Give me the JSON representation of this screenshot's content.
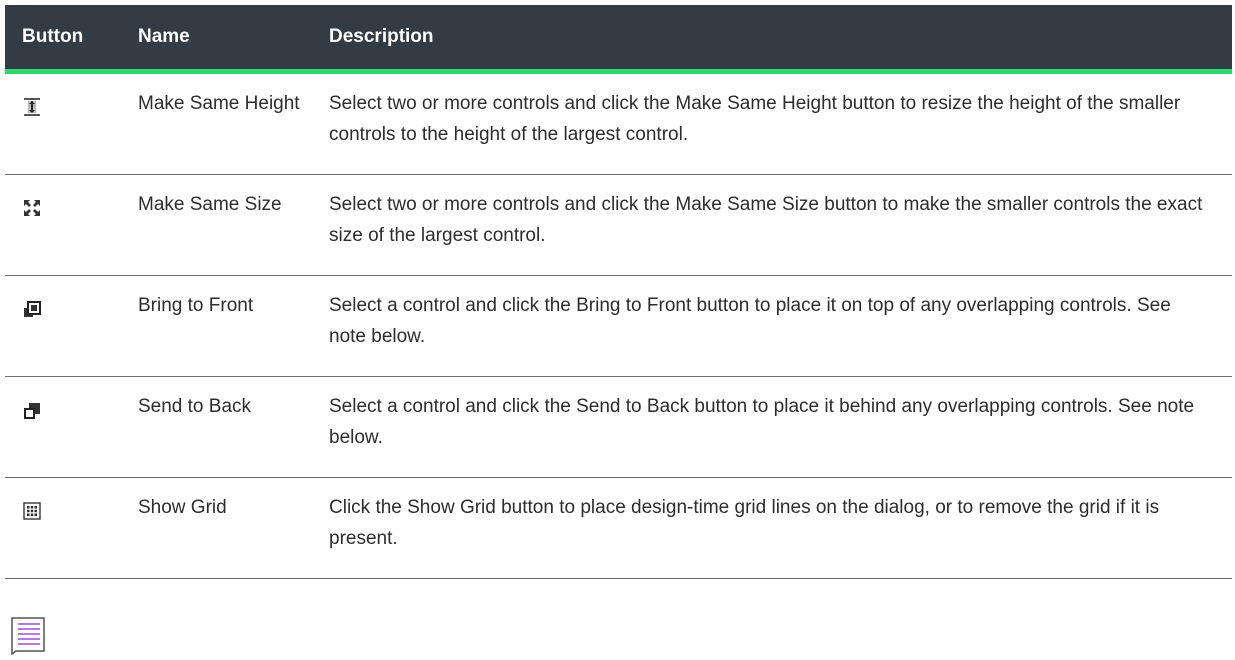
{
  "table": {
    "headers": {
      "button": "Button",
      "name": "Name",
      "description": "Description"
    },
    "rows": [
      {
        "icon": "make-same-height-icon",
        "name": "Make Same Height",
        "description": "Select two or more controls and click the Make Same Height button to resize the height of the smaller controls to the height of the largest control."
      },
      {
        "icon": "make-same-size-icon",
        "name": "Make Same Size",
        "description": "Select two or more controls and click the Make Same Size button to make the smaller controls the exact size of the largest control."
      },
      {
        "icon": "bring-to-front-icon",
        "name": "Bring to Front",
        "description": "Select a control and click the Bring to Front button to place it on top of any overlapping controls. See note below."
      },
      {
        "icon": "send-to-back-icon",
        "name": "Send to Back",
        "description": "Select a control and click the Send to Back button to place it behind any overlapping controls. See note below."
      },
      {
        "icon": "show-grid-icon",
        "name": "Show Grid",
        "description": "Click the Show Grid button to place design-time grid lines on the dialog, or to remove the grid if it is present."
      }
    ]
  },
  "note": {
    "icon": "note-icon"
  },
  "colors": {
    "header_bg": "#333b44",
    "header_accent": "#2fd66b",
    "note_accent": "#9b4fd1"
  }
}
